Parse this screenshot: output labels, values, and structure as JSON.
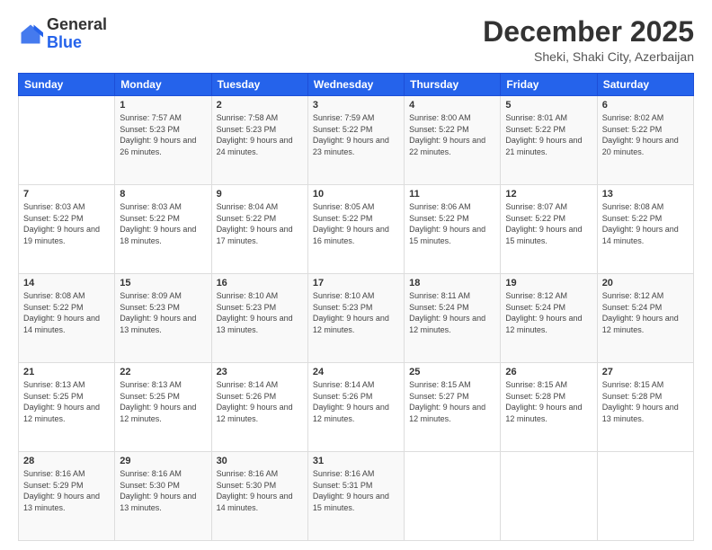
{
  "header": {
    "logo": {
      "general": "General",
      "blue": "Blue"
    },
    "title": "December 2025",
    "location": "Sheki, Shaki City, Azerbaijan"
  },
  "days_of_week": [
    "Sunday",
    "Monday",
    "Tuesday",
    "Wednesday",
    "Thursday",
    "Friday",
    "Saturday"
  ],
  "weeks": [
    [
      {
        "day": "",
        "sunrise": "",
        "sunset": "",
        "daylight": ""
      },
      {
        "day": "1",
        "sunrise": "Sunrise: 7:57 AM",
        "sunset": "Sunset: 5:23 PM",
        "daylight": "Daylight: 9 hours and 26 minutes."
      },
      {
        "day": "2",
        "sunrise": "Sunrise: 7:58 AM",
        "sunset": "Sunset: 5:23 PM",
        "daylight": "Daylight: 9 hours and 24 minutes."
      },
      {
        "day": "3",
        "sunrise": "Sunrise: 7:59 AM",
        "sunset": "Sunset: 5:22 PM",
        "daylight": "Daylight: 9 hours and 23 minutes."
      },
      {
        "day": "4",
        "sunrise": "Sunrise: 8:00 AM",
        "sunset": "Sunset: 5:22 PM",
        "daylight": "Daylight: 9 hours and 22 minutes."
      },
      {
        "day": "5",
        "sunrise": "Sunrise: 8:01 AM",
        "sunset": "Sunset: 5:22 PM",
        "daylight": "Daylight: 9 hours and 21 minutes."
      },
      {
        "day": "6",
        "sunrise": "Sunrise: 8:02 AM",
        "sunset": "Sunset: 5:22 PM",
        "daylight": "Daylight: 9 hours and 20 minutes."
      }
    ],
    [
      {
        "day": "7",
        "sunrise": "Sunrise: 8:03 AM",
        "sunset": "Sunset: 5:22 PM",
        "daylight": "Daylight: 9 hours and 19 minutes."
      },
      {
        "day": "8",
        "sunrise": "Sunrise: 8:03 AM",
        "sunset": "Sunset: 5:22 PM",
        "daylight": "Daylight: 9 hours and 18 minutes."
      },
      {
        "day": "9",
        "sunrise": "Sunrise: 8:04 AM",
        "sunset": "Sunset: 5:22 PM",
        "daylight": "Daylight: 9 hours and 17 minutes."
      },
      {
        "day": "10",
        "sunrise": "Sunrise: 8:05 AM",
        "sunset": "Sunset: 5:22 PM",
        "daylight": "Daylight: 9 hours and 16 minutes."
      },
      {
        "day": "11",
        "sunrise": "Sunrise: 8:06 AM",
        "sunset": "Sunset: 5:22 PM",
        "daylight": "Daylight: 9 hours and 15 minutes."
      },
      {
        "day": "12",
        "sunrise": "Sunrise: 8:07 AM",
        "sunset": "Sunset: 5:22 PM",
        "daylight": "Daylight: 9 hours and 15 minutes."
      },
      {
        "day": "13",
        "sunrise": "Sunrise: 8:08 AM",
        "sunset": "Sunset: 5:22 PM",
        "daylight": "Daylight: 9 hours and 14 minutes."
      }
    ],
    [
      {
        "day": "14",
        "sunrise": "Sunrise: 8:08 AM",
        "sunset": "Sunset: 5:22 PM",
        "daylight": "Daylight: 9 hours and 14 minutes."
      },
      {
        "day": "15",
        "sunrise": "Sunrise: 8:09 AM",
        "sunset": "Sunset: 5:23 PM",
        "daylight": "Daylight: 9 hours and 13 minutes."
      },
      {
        "day": "16",
        "sunrise": "Sunrise: 8:10 AM",
        "sunset": "Sunset: 5:23 PM",
        "daylight": "Daylight: 9 hours and 13 minutes."
      },
      {
        "day": "17",
        "sunrise": "Sunrise: 8:10 AM",
        "sunset": "Sunset: 5:23 PM",
        "daylight": "Daylight: 9 hours and 12 minutes."
      },
      {
        "day": "18",
        "sunrise": "Sunrise: 8:11 AM",
        "sunset": "Sunset: 5:24 PM",
        "daylight": "Daylight: 9 hours and 12 minutes."
      },
      {
        "day": "19",
        "sunrise": "Sunrise: 8:12 AM",
        "sunset": "Sunset: 5:24 PM",
        "daylight": "Daylight: 9 hours and 12 minutes."
      },
      {
        "day": "20",
        "sunrise": "Sunrise: 8:12 AM",
        "sunset": "Sunset: 5:24 PM",
        "daylight": "Daylight: 9 hours and 12 minutes."
      }
    ],
    [
      {
        "day": "21",
        "sunrise": "Sunrise: 8:13 AM",
        "sunset": "Sunset: 5:25 PM",
        "daylight": "Daylight: 9 hours and 12 minutes."
      },
      {
        "day": "22",
        "sunrise": "Sunrise: 8:13 AM",
        "sunset": "Sunset: 5:25 PM",
        "daylight": "Daylight: 9 hours and 12 minutes."
      },
      {
        "day": "23",
        "sunrise": "Sunrise: 8:14 AM",
        "sunset": "Sunset: 5:26 PM",
        "daylight": "Daylight: 9 hours and 12 minutes."
      },
      {
        "day": "24",
        "sunrise": "Sunrise: 8:14 AM",
        "sunset": "Sunset: 5:26 PM",
        "daylight": "Daylight: 9 hours and 12 minutes."
      },
      {
        "day": "25",
        "sunrise": "Sunrise: 8:15 AM",
        "sunset": "Sunset: 5:27 PM",
        "daylight": "Daylight: 9 hours and 12 minutes."
      },
      {
        "day": "26",
        "sunrise": "Sunrise: 8:15 AM",
        "sunset": "Sunset: 5:28 PM",
        "daylight": "Daylight: 9 hours and 12 minutes."
      },
      {
        "day": "27",
        "sunrise": "Sunrise: 8:15 AM",
        "sunset": "Sunset: 5:28 PM",
        "daylight": "Daylight: 9 hours and 13 minutes."
      }
    ],
    [
      {
        "day": "28",
        "sunrise": "Sunrise: 8:16 AM",
        "sunset": "Sunset: 5:29 PM",
        "daylight": "Daylight: 9 hours and 13 minutes."
      },
      {
        "day": "29",
        "sunrise": "Sunrise: 8:16 AM",
        "sunset": "Sunset: 5:30 PM",
        "daylight": "Daylight: 9 hours and 13 minutes."
      },
      {
        "day": "30",
        "sunrise": "Sunrise: 8:16 AM",
        "sunset": "Sunset: 5:30 PM",
        "daylight": "Daylight: 9 hours and 14 minutes."
      },
      {
        "day": "31",
        "sunrise": "Sunrise: 8:16 AM",
        "sunset": "Sunset: 5:31 PM",
        "daylight": "Daylight: 9 hours and 15 minutes."
      },
      {
        "day": "",
        "sunrise": "",
        "sunset": "",
        "daylight": ""
      },
      {
        "day": "",
        "sunrise": "",
        "sunset": "",
        "daylight": ""
      },
      {
        "day": "",
        "sunrise": "",
        "sunset": "",
        "daylight": ""
      }
    ]
  ]
}
